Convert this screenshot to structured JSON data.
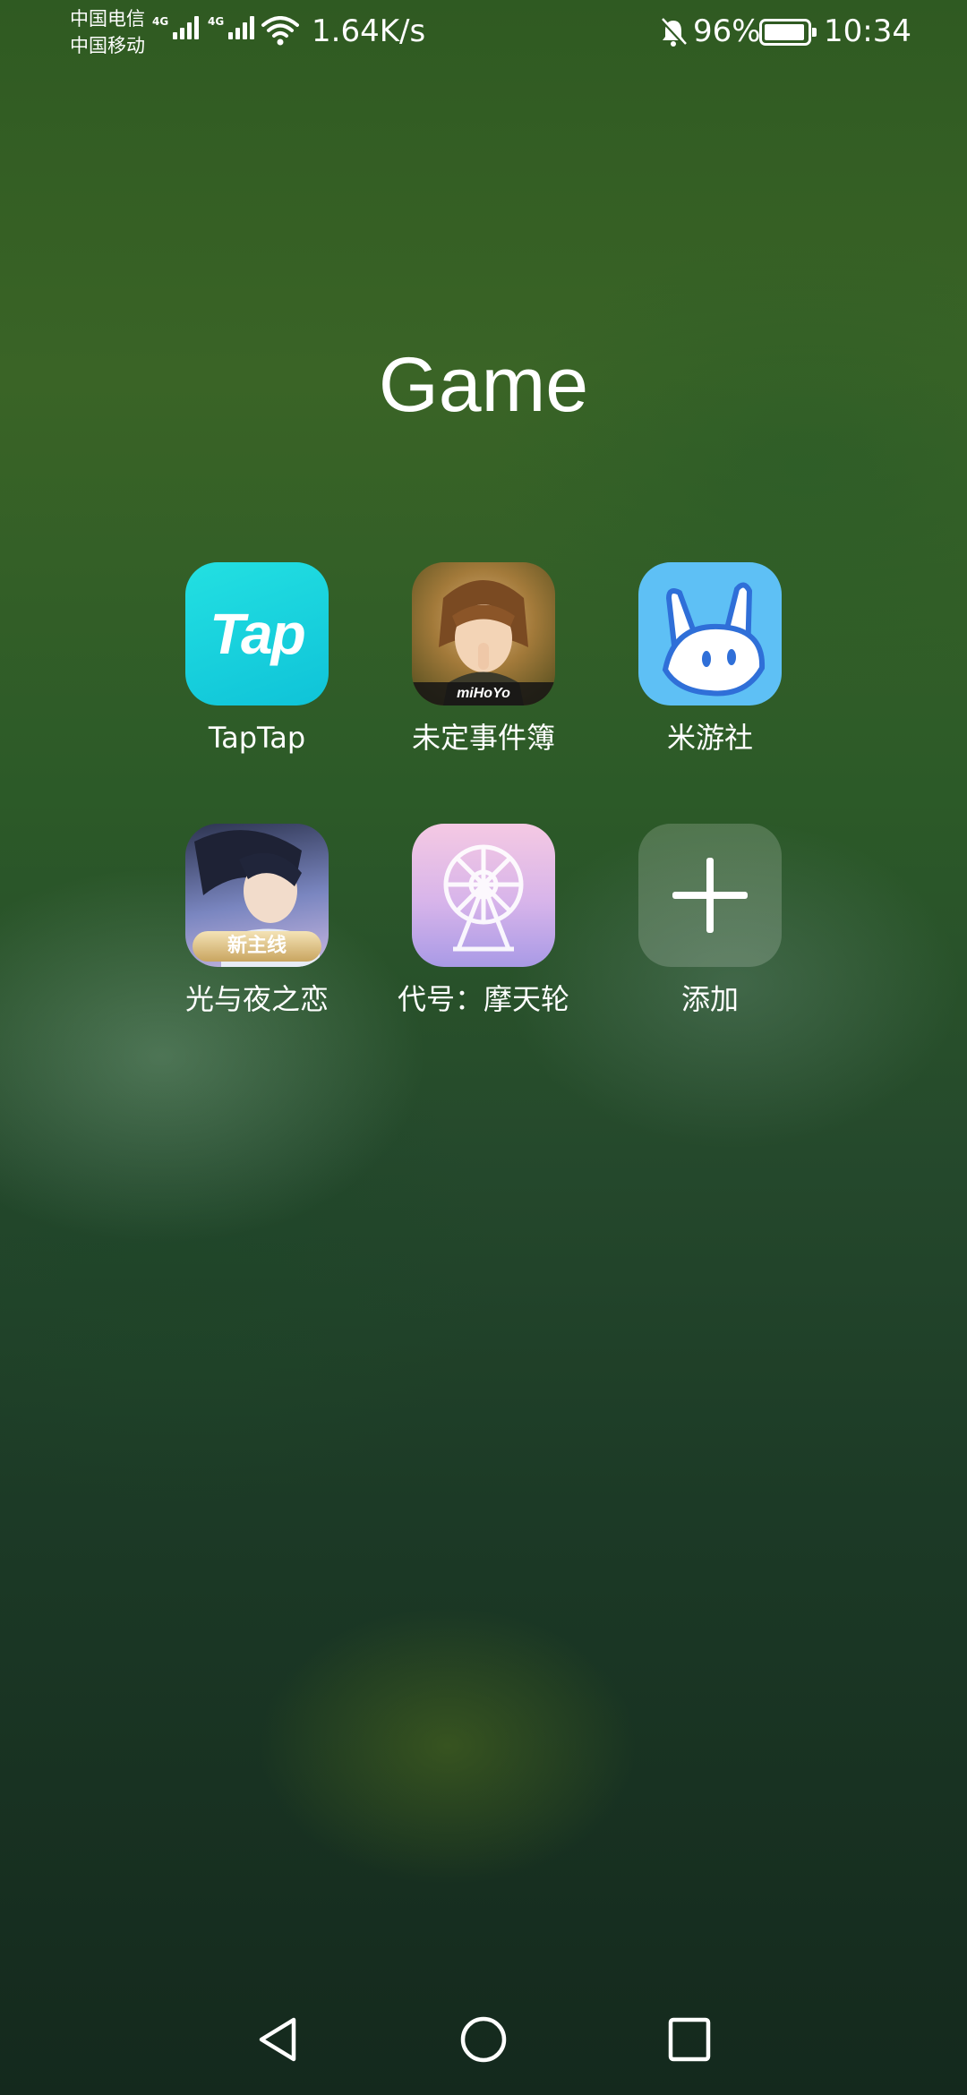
{
  "status_bar": {
    "carrier_1": "中国电信",
    "carrier_2": "中国移动",
    "sim1_tech": "4G",
    "sim2_tech": "4G",
    "net_speed": "1.64K/s",
    "battery": "96%",
    "battery_level": 0.96,
    "time": "10:34",
    "icons": [
      "signal-icon",
      "wifi-icon",
      "bell-muted-icon",
      "battery-icon"
    ]
  },
  "folder": {
    "title": "Game",
    "apps": [
      {
        "label": "TapTap",
        "icon_text": "Tap",
        "color": "#18d0de"
      },
      {
        "label": "未定事件簿",
        "icon_text": "miHoYo",
        "color": "#a37a3a"
      },
      {
        "label": "米游社",
        "color": "#5ec0f5"
      },
      {
        "label": "光与夜之恋",
        "icon_text": "新主线",
        "color": "#7a86c0"
      },
      {
        "label": "代号：摩天轮",
        "color": "#d7b4ea"
      },
      {
        "label": "添加"
      }
    ]
  },
  "navbar": {
    "icons": [
      "back-icon",
      "home-icon",
      "recents-icon"
    ]
  }
}
